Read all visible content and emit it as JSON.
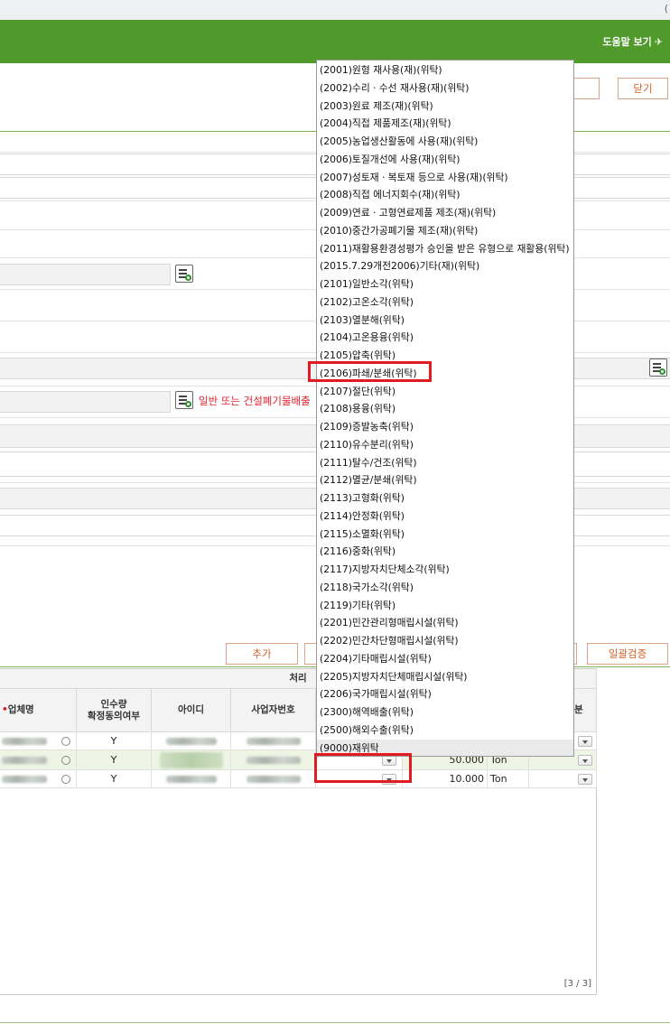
{
  "window": {
    "corner_char": "("
  },
  "header": {
    "help_label": "도움말 보기",
    "bg_color": "#4f9a2b"
  },
  "buttons": {
    "close": "닫기",
    "add": "추가",
    "batch_verify": "일괄검증"
  },
  "form": {
    "notice_text": "일반 또는 건설폐기물배출"
  },
  "dropdown_options": [
    "(2001)원형 재사용(재)(위탁)",
    "(2002)수리ㆍ수선 재사용(재)(위탁)",
    "(2003)원료 제조(재)(위탁)",
    "(2004)직접 제품제조(재)(위탁)",
    "(2005)농업생산활동에 사용(재)(위탁)",
    "(2006)토질개선에 사용(재)(위탁)",
    "(2007)성토재ㆍ복토재 등으로 사용(재)(위탁)",
    "(2008)직접 에너지회수(재)(위탁)",
    "(2009)연료ㆍ고형연료제품 제조(재)(위탁)",
    "(2010)중간가공폐기물 제조(재)(위탁)",
    "(2011)재활용환경성평가 승인을 받은 유형으로 재활용(위탁)",
    "(2015.7.29개전2006)기타(재)(위탁)",
    "(2101)일반소각(위탁)",
    "(2102)고온소각(위탁)",
    "(2103)열분해(위탁)",
    "(2104)고온용융(위탁)",
    "(2105)압축(위탁)",
    "(2106)파쇄/분쇄(위탁)",
    "(2107)절단(위탁)",
    "(2108)용융(위탁)",
    "(2109)증발농축(위탁)",
    "(2110)유수분리(위탁)",
    "(2111)탈수/건조(위탁)",
    "(2112)멸균/분쇄(위탁)",
    "(2113)고형화(위탁)",
    "(2114)안정화(위탁)",
    "(2115)소멸화(위탁)",
    "(2116)중화(위탁)",
    "(2117)지방자치단체소각(위탁)",
    "(2118)국가소각(위탁)",
    "(2119)기타(위탁)",
    "(2201)민간관리형매립시설(위탁)",
    "(2202)민간차단형매립시설(위탁)",
    "(2204)기타매립시설(위탁)",
    "(2205)지방자치단체매립시설(위탁)",
    "(2206)국가매립시설(위탁)",
    "(2300)해역배출(위탁)",
    "(2500)해외수출(위탁)",
    "(9000)재위탁"
  ],
  "grid": {
    "group_header": "처리",
    "col_company": "업체명",
    "col_consent": "인수량\n확정동의여부",
    "col_id": "아이디",
    "col_bizno": "사업자번호",
    "col_division_partial": "분",
    "rows": [
      {
        "consent": "Y",
        "qty": "",
        "unit": ""
      },
      {
        "consent": "Y",
        "qty": "50.000",
        "unit": "Ton"
      },
      {
        "consent": "Y",
        "qty": "10.000",
        "unit": "Ton"
      }
    ],
    "pager": "[3 / 3]"
  }
}
